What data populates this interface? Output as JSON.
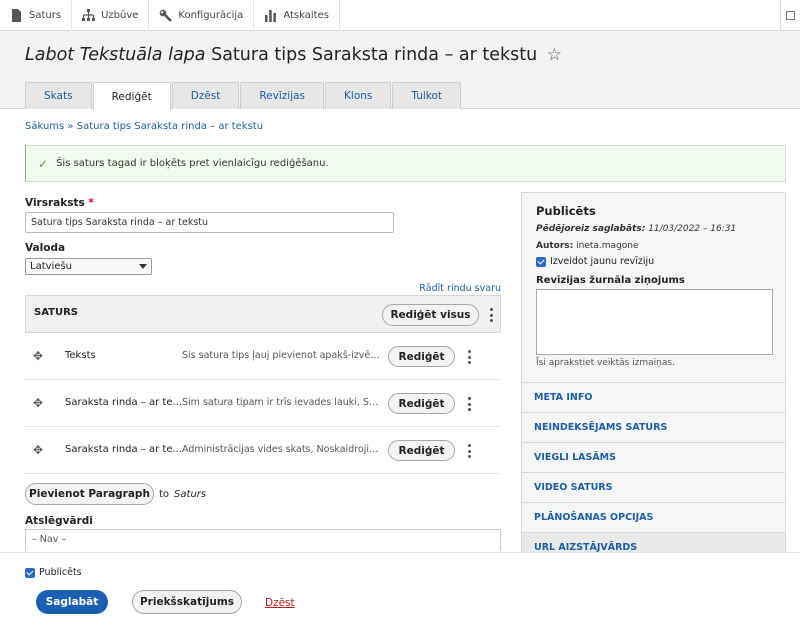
{
  "toolbar": {
    "items": [
      {
        "label": "Saturs",
        "icon": "file-icon"
      },
      {
        "label": "Uzbūve",
        "icon": "sitemap-icon"
      },
      {
        "label": "Konfigurācija",
        "icon": "wrench-icon"
      },
      {
        "label": "Atskaites",
        "icon": "bar-chart-icon"
      }
    ]
  },
  "header": {
    "title_italic": "Labot Tekstuāla lapa",
    "title_rest": "Satura tips Saraksta rinda – ar tekstu",
    "tabs": [
      "Skats",
      "Rediģēt",
      "Dzēst",
      "Revīzijas",
      "Klons",
      "Tulkot"
    ],
    "active_tab": "Rediģēt"
  },
  "breadcrumb": "Sākums » Satura tips Saraksta rinda – ar tekstu",
  "message": "Šis saturs tagad ir bloķēts pret vienlaicīgu rediģēšanu.",
  "form": {
    "title_label": "Virsraksts",
    "title_required": "*",
    "title_value": "Satura tips Saraksta rinda – ar tekstu",
    "lang_label": "Valoda",
    "lang_value": "Latviešu",
    "row_weights_link": "Rādīt rindu svaru",
    "content_heading": "SATURS",
    "edit_all_label": "Rediģēt visus",
    "paragraphs": [
      {
        "name": "Teksts",
        "desc": "Šis satura tips ļauj pievienot apakš-izvēlni",
        "edit": "Rediģēt"
      },
      {
        "name": "Saraksta rinda – ar te...",
        "desc": "Šim satura tipam ir trīs ievades lauki, Šie lauki",
        "edit": "Rediģēt"
      },
      {
        "name": "Saraksta rinda – ar te...",
        "desc": "Administrācijas vides skats, Noskaidrojiet vairāk",
        "edit": "Rediģēt"
      }
    ],
    "add_paragraph_label": "Pievienot Paragraph",
    "add_to": "to",
    "add_target": "Saturs",
    "keywords_label": "Atslēgvārdi",
    "keywords_value": "– Nav –"
  },
  "sidebar": {
    "title": "Publicēts",
    "last_saved_label": "Pēdējoreiz saglabāts:",
    "last_saved_value": "11/03/2022 – 16:31",
    "author_label": "Autors:",
    "author_value": "ineta.magone",
    "new_revision_label": "Izveidot jaunu revīziju",
    "new_revision_checked": true,
    "revision_log_label": "Revīzijas žurnāla ziņojums",
    "revision_log_hint": "Īsi aprakstiet veiktās izmaiņas.",
    "sections": [
      "META INFO",
      "NEINDEKSĒJAMS SATURS",
      "VIEGLI LASĀMS",
      "VIDEO SATURS",
      "PLĀNOŠANAS OPCIJAS",
      "URL AIZSTĀJVĀRDS"
    ]
  },
  "footer": {
    "published_label": "Publicēts",
    "published_checked": true,
    "save_label": "Saglabāt",
    "preview_label": "Priekšskatījums",
    "delete_label": "Dzēst"
  },
  "colors": {
    "accent": "#1b5fb3",
    "link": "#1a5fa8",
    "success_bg": "#f1fbee",
    "danger": "#c21818"
  }
}
